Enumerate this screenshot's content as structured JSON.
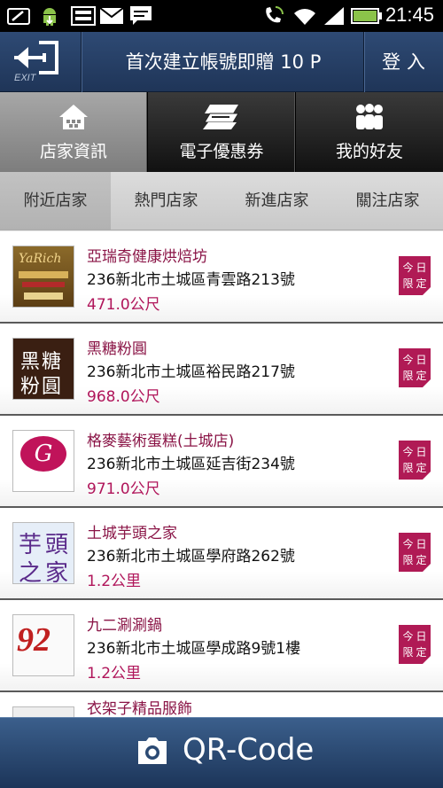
{
  "status_bar": {
    "time": "21:45",
    "icons": [
      "screenshot-icon",
      "android-icon",
      "image-icon",
      "mail-icon",
      "chat-icon",
      "phone-wifi-icon",
      "wifi-icon",
      "signal-icon",
      "battery-icon"
    ]
  },
  "header": {
    "exit_label": "EXIT",
    "title": "首次建立帳號即贈 10 P",
    "login_label": "登 入"
  },
  "main_tabs": [
    {
      "label": "店家資訊",
      "icon": "store-icon",
      "active": true
    },
    {
      "label": "電子優惠券",
      "icon": "coupon-icon",
      "active": false
    },
    {
      "label": "我的好友",
      "icon": "friends-icon",
      "active": false
    }
  ],
  "sub_tabs": [
    {
      "label": "附近店家",
      "active": true
    },
    {
      "label": "熱門店家",
      "active": false
    },
    {
      "label": "新進店家",
      "active": false
    },
    {
      "label": "關注店家",
      "active": false
    }
  ],
  "stores": [
    {
      "name": "亞瑞奇健康烘焙坊",
      "address": "236新北市土城區青雲路213號",
      "distance": "471.0公尺",
      "badge": [
        "今日",
        "限定"
      ],
      "logo_text": "YaRich"
    },
    {
      "name": "黑糖粉圓",
      "address": "236新北市土城區裕民路217號",
      "distance": "968.0公尺",
      "badge": [
        "今日",
        "限定"
      ],
      "logo_text": [
        "黑糖",
        "粉圓"
      ]
    },
    {
      "name": "格麥藝術蛋糕(土城店)",
      "address": "236新北市土城區延吉街234號",
      "distance": "971.0公尺",
      "badge": [
        "今日",
        "限定"
      ],
      "logo_text": "G"
    },
    {
      "name": "土城芋頭之家",
      "address": "236新北市土城區學府路262號",
      "distance": "1.2公里",
      "badge": [
        "今日",
        "限定"
      ],
      "logo_text": [
        "芋",
        "頭",
        "之",
        "家"
      ]
    },
    {
      "name": "九二涮涮鍋",
      "address": "236新北市土城區學成路9號1樓",
      "distance": "1.2公里",
      "badge": [
        "今日",
        "限定"
      ],
      "logo_text": "92"
    },
    {
      "name": "衣架子精品服飾",
      "address": "",
      "distance": "",
      "badge": [],
      "logo_text": ""
    }
  ],
  "bottom_bar": {
    "label": "QR-Code",
    "icon": "camera-icon"
  },
  "colors": {
    "header_bg": "#2e4a74",
    "store_name": "#8a1446",
    "distance": "#b0155a",
    "badge_bg": "#b01a55"
  }
}
